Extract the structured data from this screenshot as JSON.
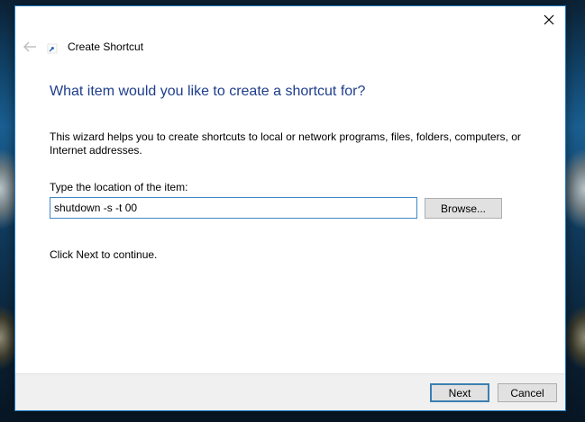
{
  "window": {
    "title": "Create Shortcut",
    "close_icon": "close-icon",
    "back_icon": "back-arrow-icon",
    "title_icon": "shortcut-icon"
  },
  "main": {
    "heading": "What item would you like to create a shortcut for?",
    "description": "This wizard helps you to create shortcuts to local or network programs, files, folders, computers, or Internet addresses.",
    "location_label": "Type the location of the item:",
    "location_value": "shutdown -s -t 00",
    "browse_label": "Browse...",
    "hint": "Click Next to continue."
  },
  "footer": {
    "next_label": "Next",
    "cancel_label": "Cancel"
  },
  "colors": {
    "accent": "#1c79c0",
    "heading": "#1e3d8c",
    "footer_bg": "#f0f0f0"
  }
}
